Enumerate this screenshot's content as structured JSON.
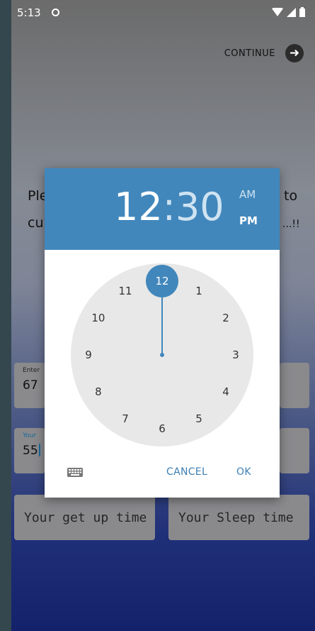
{
  "status_bar": {
    "time": "5:13"
  },
  "header": {
    "continue_label": "CONTINUE"
  },
  "background": {
    "line1_left": "Ple",
    "line1_right": "to",
    "line2_left": "cu",
    "line2_right": "...!!",
    "field_weight": {
      "label": "Enter",
      "value": "67"
    },
    "field_age": {
      "label": "Your",
      "value": "55"
    },
    "getup_placeholder": "Your get up time",
    "sleep_placeholder": "Your Sleep time"
  },
  "time_picker": {
    "hour": "12",
    "colon": ":",
    "minute": "30",
    "am_label": "AM",
    "pm_label": "PM",
    "selected_period": "PM",
    "clock_numbers": [
      "12",
      "1",
      "2",
      "3",
      "4",
      "5",
      "6",
      "7",
      "8",
      "9",
      "10",
      "11"
    ],
    "selected_hour": "12",
    "cancel_label": "CANCEL",
    "ok_label": "OK"
  },
  "colors": {
    "accent": "#4187bc",
    "clock_face": "#e8e8e8",
    "button_text": "#3d7fb3"
  },
  "icons": {
    "status_notification": "circle-icon",
    "wifi": "wifi-icon",
    "signal": "signal-icon",
    "battery": "battery-icon",
    "continue": "arrow-right-icon",
    "keyboard": "keyboard-icon"
  }
}
